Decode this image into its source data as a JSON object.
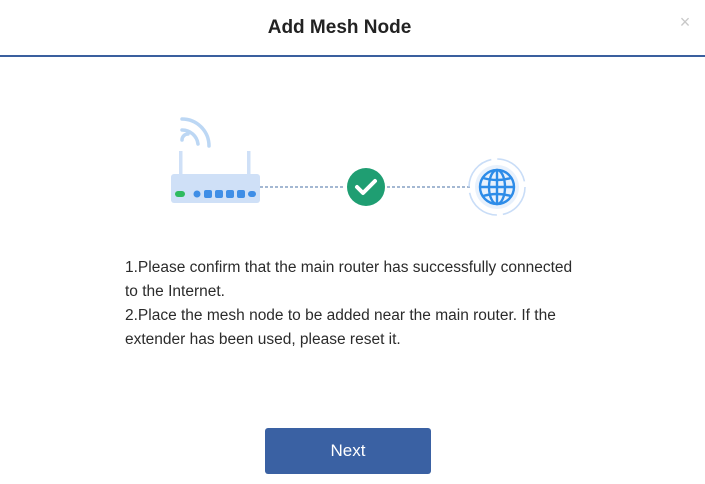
{
  "dialog": {
    "title": "Add Mesh Node",
    "close_glyph": "×"
  },
  "illustration": {
    "icons": [
      "router-icon",
      "wifi-signal-icon",
      "check-circle-icon",
      "globe-icon"
    ],
    "colors": {
      "router": "#cfe0f7",
      "router_leds": "#3f8ee6",
      "router_power_led": "#2fbb5f",
      "wifi": "#bcd7f4",
      "check": "#1f9e72",
      "globe": "#2d8ce8",
      "globe_ring": "#c9ddf7",
      "connector": "#6e8eb8"
    }
  },
  "instructions": {
    "step1": "1.Please confirm that the main router has successfully connected to the Internet.",
    "step2": "2.Place the mesh node to be added near the main router. If the extender has been used, please reset it."
  },
  "footer": {
    "next_label": "Next"
  },
  "theme": {
    "primary": "#3a61a3",
    "header_border": "#3a5f9e"
  }
}
